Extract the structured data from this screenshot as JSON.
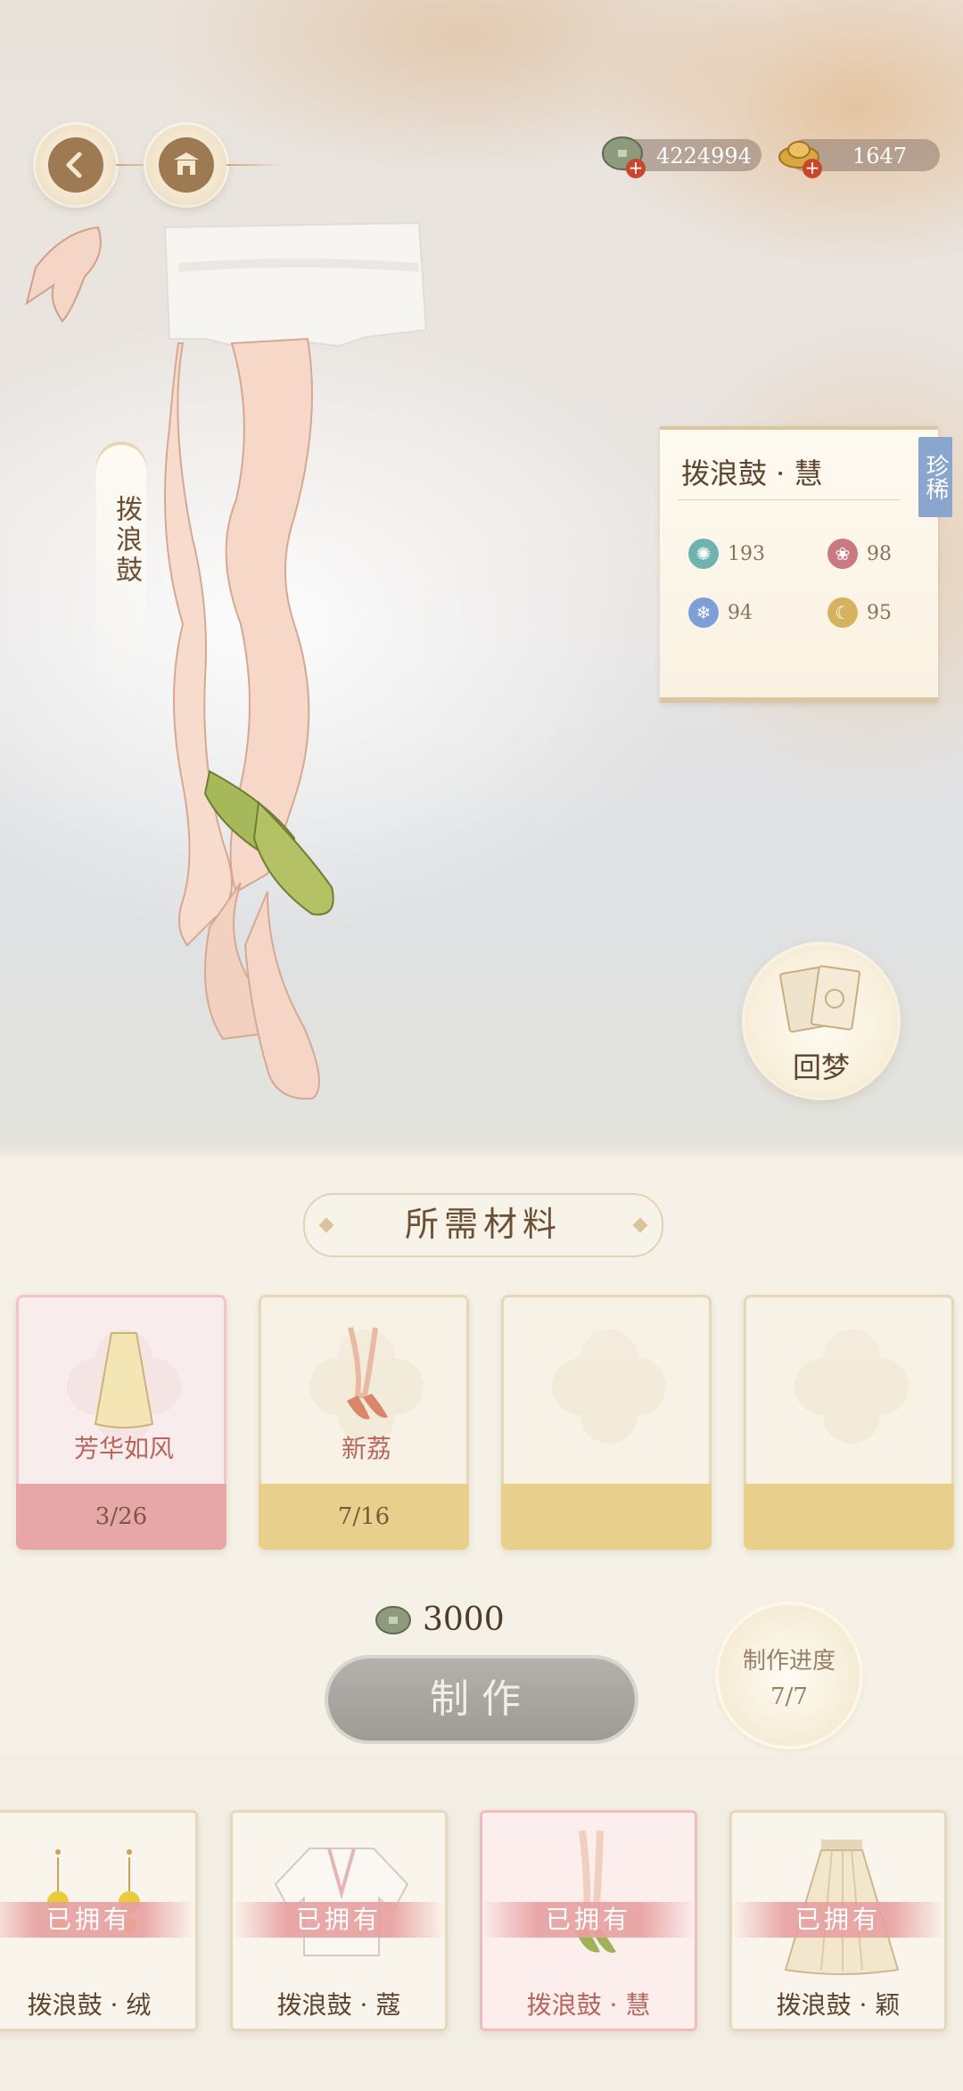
{
  "currencies": {
    "coins": "4224994",
    "ingots": "1647"
  },
  "item": {
    "vertical_name": "拨浪鼓",
    "title": "拨浪鼓 · 慧",
    "rarity": "珍稀",
    "stats": [
      {
        "icon": "wind-swirl-icon",
        "value": "193",
        "color": "#6fb3b0"
      },
      {
        "icon": "lotus-icon",
        "value": "98",
        "color": "#c97a80"
      },
      {
        "icon": "snowflake-icon",
        "value": "94",
        "color": "#7c9fd8"
      },
      {
        "icon": "crescent-moon-icon",
        "value": "95",
        "color": "#d6b25f"
      }
    ]
  },
  "dream_button": "回梦",
  "materials_title": "所需材料",
  "materials": [
    {
      "name": "芳华如风",
      "count": "3/26",
      "style": "pink"
    },
    {
      "name": "新荔",
      "count": "7/16",
      "style": "gold"
    },
    {
      "name": "",
      "count": "",
      "style": "gold"
    },
    {
      "name": "",
      "count": "",
      "style": "gold"
    }
  ],
  "cost": "3000",
  "make_button": "制作",
  "progress": {
    "label": "制作进度",
    "value": "7/7"
  },
  "owned_label": "已拥有",
  "set_items": [
    {
      "name": "拨浪鼓 · 绒",
      "owned": "已拥有"
    },
    {
      "name": "拨浪鼓 · 蔻",
      "owned": "已拥有"
    },
    {
      "name": "拨浪鼓 · 慧",
      "owned": "已拥有"
    },
    {
      "name": "拨浪鼓 · 颖",
      "owned": "已拥有"
    }
  ]
}
